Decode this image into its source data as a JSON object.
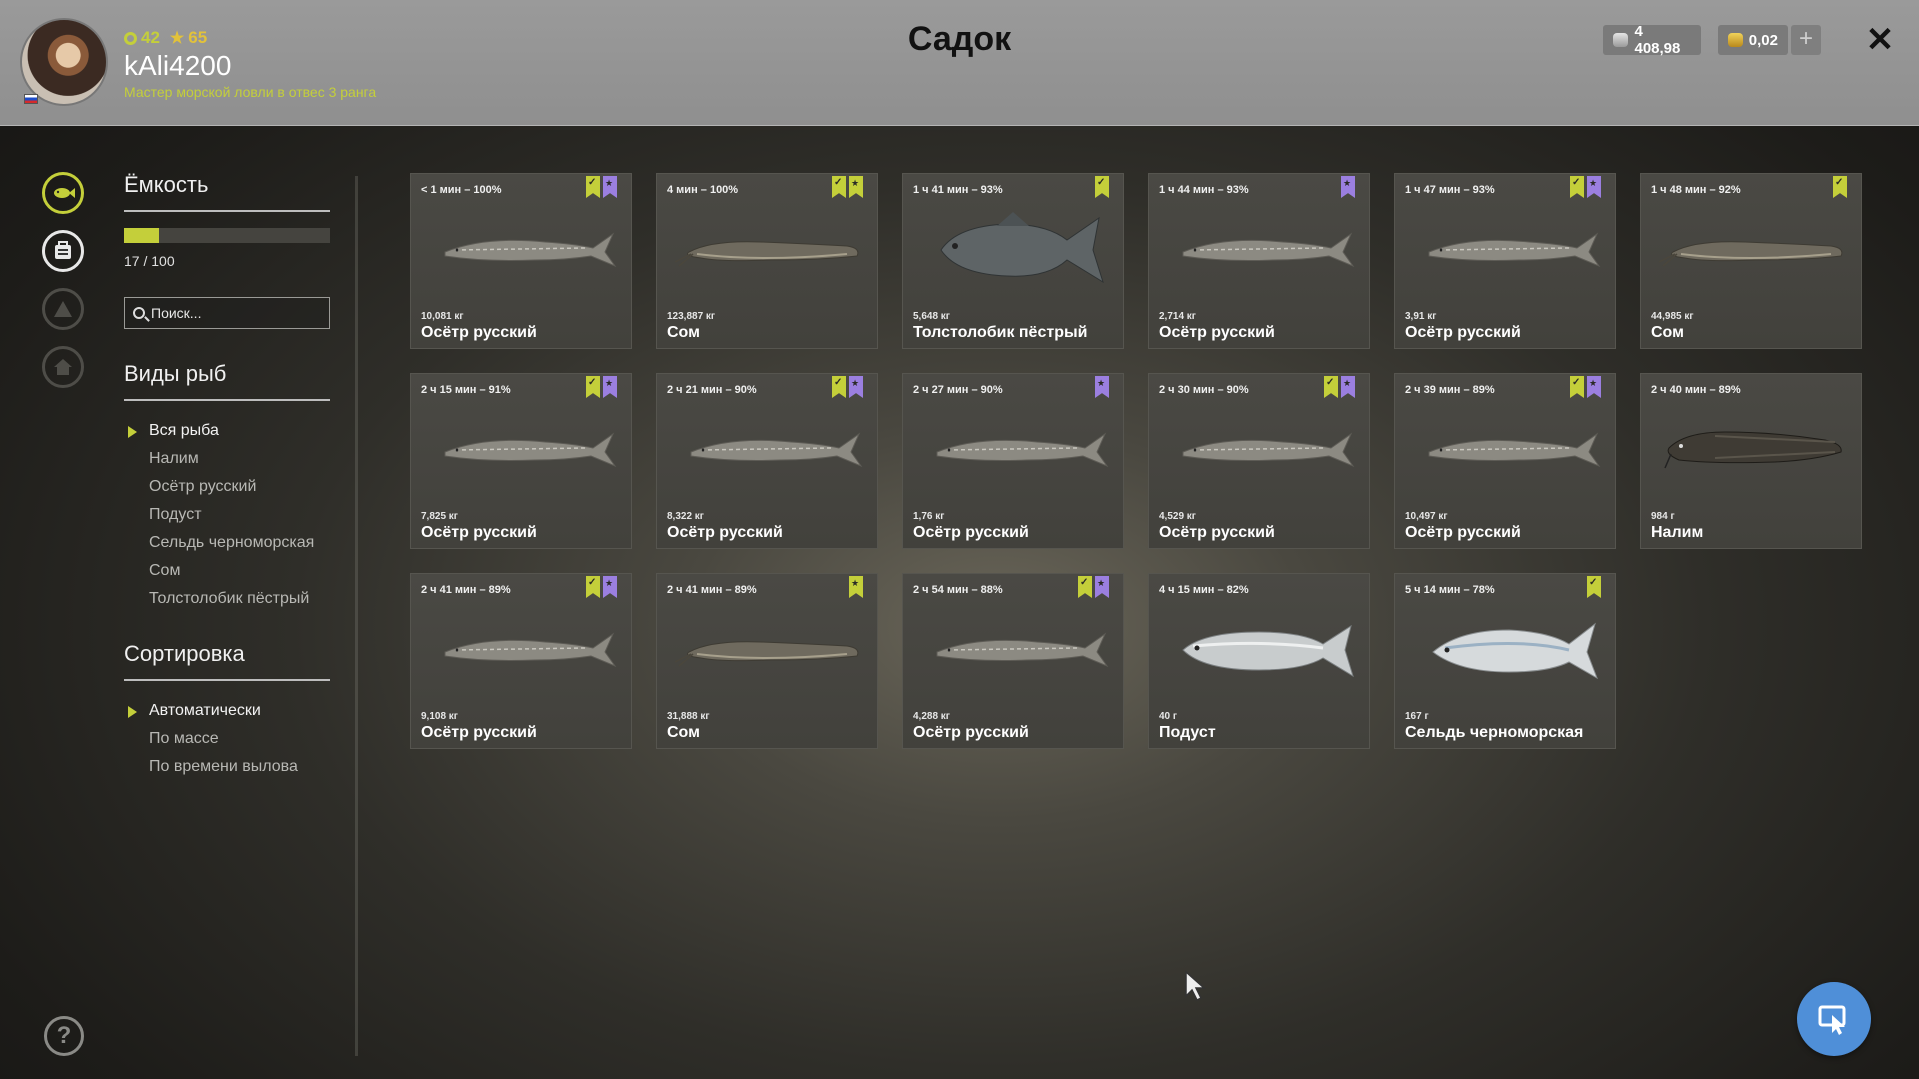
{
  "header": {
    "title": "Садок",
    "player": {
      "level": "42",
      "rank_level": "65",
      "username": "kAli4200",
      "rank_title": "Мастер морской ловли в отвес 3 ранга"
    },
    "currency": {
      "silver": "4 408,98",
      "gold": "0,02",
      "add_label": "+"
    },
    "close_label": "✕"
  },
  "colors": {
    "accent": "#c4cf3a",
    "purple_mark": "#9b7fe0",
    "button_blue": "#4f8fd8"
  },
  "capacity": {
    "title": "Ёмкость",
    "used": 17,
    "total": 100,
    "text": "17 / 100",
    "fill_fraction": 0.17
  },
  "search": {
    "placeholder": "Поиск..."
  },
  "species": {
    "title": "Виды рыб",
    "items": [
      "Вся рыба",
      "Налим",
      "Осётр русский",
      "Подуст",
      "Сельдь черноморская",
      "Сом",
      "Толстолобик пёстрый"
    ],
    "selected": 0
  },
  "sorting": {
    "title": "Сортировка",
    "items": [
      "Автоматически",
      "По массе",
      "По времени вылова"
    ],
    "selected": 0
  },
  "fish": [
    {
      "time": "< 1 мин – 100%",
      "weight": "10,081 кг",
      "name": "Осётр русский",
      "type": "sturgeon",
      "marks": [
        "green-check",
        "purple-star"
      ]
    },
    {
      "time": "4 мин – 100%",
      "weight": "123,887 кг",
      "name": "Сом",
      "type": "catfish",
      "marks": [
        "green-check",
        "green-star"
      ]
    },
    {
      "time": "1 ч 41 мин – 93%",
      "weight": "5,648 кг",
      "name": "Толстолобик пёстрый",
      "type": "carp",
      "marks": [
        "green-check"
      ]
    },
    {
      "time": "1 ч 44 мин – 93%",
      "weight": "2,714 кг",
      "name": "Осётр русский",
      "type": "sturgeon",
      "marks": [
        "purple-star"
      ]
    },
    {
      "time": "1 ч 47 мин – 93%",
      "weight": "3,91 кг",
      "name": "Осётр русский",
      "type": "sturgeon",
      "marks": [
        "green-check",
        "purple-star"
      ]
    },
    {
      "time": "1 ч 48 мин – 92%",
      "weight": "44,985 кг",
      "name": "Сом",
      "type": "catfish",
      "marks": [
        "green-check"
      ]
    },
    {
      "time": "2 ч 15 мин – 91%",
      "weight": "7,825 кг",
      "name": "Осётр русский",
      "type": "sturgeon",
      "marks": [
        "green-check",
        "purple-star"
      ]
    },
    {
      "time": "2 ч 21 мин – 90%",
      "weight": "8,322 кг",
      "name": "Осётр русский",
      "type": "sturgeon",
      "marks": [
        "green-check",
        "purple-star"
      ]
    },
    {
      "time": "2 ч 27 мин – 90%",
      "weight": "1,76 кг",
      "name": "Осётр русский",
      "type": "sturgeon",
      "marks": [
        "purple-star"
      ]
    },
    {
      "time": "2 ч 30 мин – 90%",
      "weight": "4,529 кг",
      "name": "Осётр русский",
      "type": "sturgeon",
      "marks": [
        "green-check",
        "purple-star"
      ]
    },
    {
      "time": "2 ч 39 мин – 89%",
      "weight": "10,497 кг",
      "name": "Осётр русский",
      "type": "sturgeon",
      "marks": [
        "green-check",
        "purple-star"
      ]
    },
    {
      "time": "2 ч 40 мин – 89%",
      "weight": "984 г",
      "name": "Налим",
      "type": "burbot",
      "marks": []
    },
    {
      "time": "2 ч 41 мин – 89%",
      "weight": "9,108 кг",
      "name": "Осётр русский",
      "type": "sturgeon",
      "marks": [
        "green-check",
        "purple-star"
      ]
    },
    {
      "time": "2 ч 41 мин – 89%",
      "weight": "31,888 кг",
      "name": "Сом",
      "type": "catfish",
      "marks": [
        "green-star"
      ]
    },
    {
      "time": "2 ч 54 мин – 88%",
      "weight": "4,288 кг",
      "name": "Осётр русский",
      "type": "sturgeon",
      "marks": [
        "green-check",
        "purple-star"
      ]
    },
    {
      "time": "4 ч 15 мин – 82%",
      "weight": "40 г",
      "name": "Подуст",
      "type": "nase",
      "marks": []
    },
    {
      "time": "5 ч 14 мин – 78%",
      "weight": "167 г",
      "name": "Сельдь черноморская",
      "type": "herring",
      "marks": [
        "green-check"
      ]
    }
  ]
}
